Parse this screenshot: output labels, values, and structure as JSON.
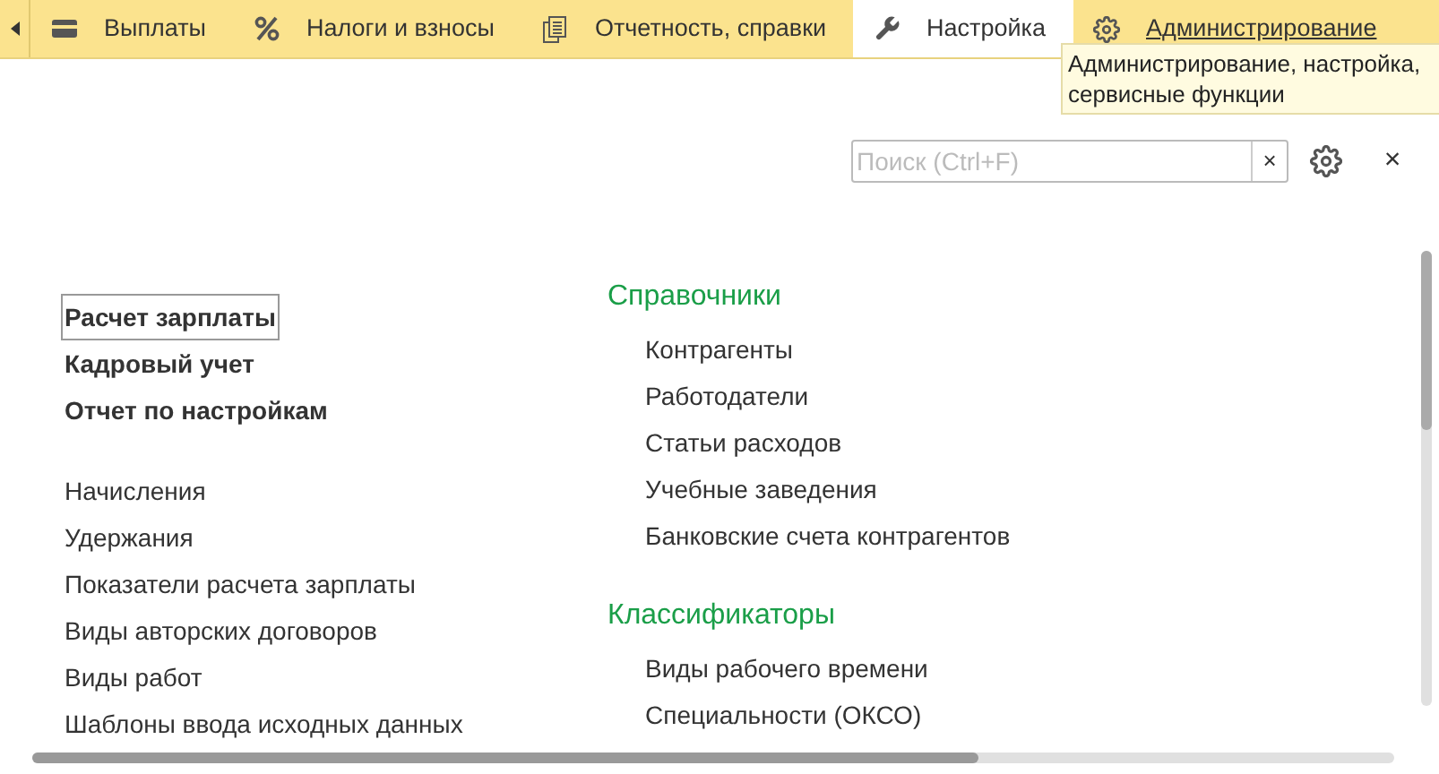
{
  "tabs": [
    {
      "label": "Выплаты",
      "kind": "wallet",
      "selected": false,
      "hovered": false
    },
    {
      "label": "Налоги и взносы",
      "kind": "percent",
      "selected": false,
      "hovered": false
    },
    {
      "label": "Отчетность, справки",
      "kind": "docs",
      "selected": false,
      "hovered": false
    },
    {
      "label": "Настройка",
      "kind": "wrench",
      "selected": true,
      "hovered": false
    },
    {
      "label": "Администрирование",
      "kind": "gear",
      "selected": false,
      "hovered": true
    }
  ],
  "tooltip": "Администрирование, настройка, сервисные функции",
  "search": {
    "placeholder": "Поиск (Ctrl+F)",
    "clear": "×"
  },
  "close": "×",
  "left_groups": [
    {
      "kind": "bold",
      "items": [
        {
          "label": "Расчет зарплаты",
          "focused": true
        },
        {
          "label": "Кадровый учет",
          "focused": false
        },
        {
          "label": "Отчет по настройкам",
          "focused": false
        }
      ]
    },
    {
      "kind": "plain",
      "items": [
        {
          "label": "Начисления",
          "focused": false
        },
        {
          "label": "Удержания",
          "focused": false
        },
        {
          "label": "Показатели расчета зарплаты",
          "focused": false
        },
        {
          "label": "Виды авторских договоров",
          "focused": false
        },
        {
          "label": "Виды работ",
          "focused": false
        },
        {
          "label": "Шаблоны ввода исходных данных",
          "focused": false
        }
      ]
    }
  ],
  "right_sections": [
    {
      "title": "Справочники",
      "items": [
        "Контрагенты",
        "Работодатели",
        "Статьи расходов",
        "Учебные заведения",
        "Банковские счета контрагентов"
      ]
    },
    {
      "title": "Классификаторы",
      "items": [
        "Виды рабочего времени",
        "Специальности (ОКСО)"
      ]
    }
  ]
}
